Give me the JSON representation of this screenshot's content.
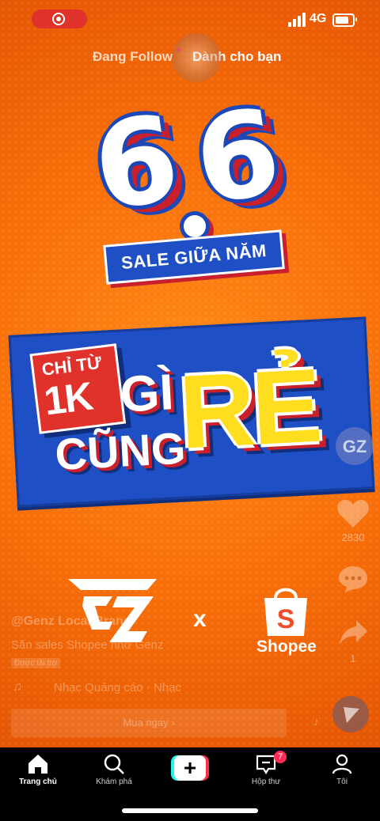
{
  "status_bar": {
    "network": "4G",
    "signal_bars": 4,
    "icons": [
      "screen-record-icon",
      "signal-icon",
      "battery-icon"
    ]
  },
  "top_tabs": {
    "following": "Đang Follow",
    "for_you": "Dành cho bạn"
  },
  "ad_creative": {
    "headline_left": "6",
    "headline_right": "6",
    "sale_banner": "SALE GIỮA NĂM",
    "chitu": "CHỈ TỪ",
    "onek": "1K",
    "gi": "GÌ",
    "cung": "CŨNG",
    "re": "RẺ",
    "times": "x",
    "shopee_word": "Shopee"
  },
  "post": {
    "author": "@Genz Local Brand",
    "description": "Săn sales Shopee nhớ Genz",
    "sponsored": "Được tài trợ",
    "music": "Nhạc Quảng cáo · Nhạc",
    "cta": "Mua ngay ›"
  },
  "sidebar": {
    "likes": "2830",
    "shares": "1",
    "icons": [
      "brand-avatar-icon",
      "heart-icon",
      "comment-icon",
      "share-icon",
      "music-disc-icon"
    ]
  },
  "bottom_nav": {
    "home": "Trang chủ",
    "discover": "Khám phá",
    "create": "+",
    "inbox": "Hộp thư",
    "inbox_badge": "7",
    "profile": "Tôi"
  },
  "colors": {
    "background": "#f86f0a",
    "panel_blue": "#1e4fc4",
    "accent_red": "#e0322b",
    "yellow": "#ffde1f",
    "tiktok_pink": "#fe2c55",
    "tiktok_cyan": "#25f4ee"
  }
}
